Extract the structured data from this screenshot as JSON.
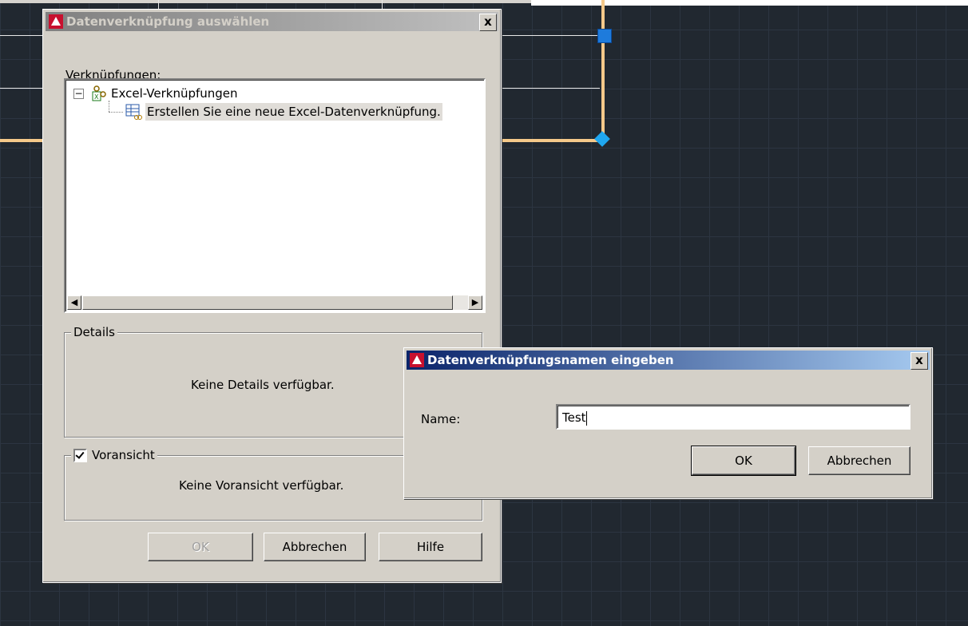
{
  "dialog_main": {
    "title": "Datenverknüpfung auswählen",
    "close_label": "x",
    "links_label": "Verknüpfungen:",
    "tree": {
      "root_label": "Excel-Verknüpfungen",
      "expander": "−",
      "child_label": "Erstellen Sie eine neue Excel-Datenverknüpfung."
    },
    "scroll_left": "◀",
    "scroll_right": "▶",
    "details_label": "Details",
    "details_text": "Keine Details verfügbar.",
    "preview_label": "Voransicht",
    "preview_text": "Keine Voransicht verfügbar.",
    "ok_label": "OK",
    "cancel_label": "Abbrechen",
    "help_label": "Hilfe"
  },
  "dialog_name": {
    "title": "Datenverknüpfungsnamen eingeben",
    "close_label": "x",
    "name_label": "Name:",
    "name_value": "Test",
    "ok_label": "OK",
    "cancel_label": "Abbrechen"
  },
  "colors": {
    "cad_background": "#212830",
    "grip_selected": "#1e7bdc",
    "polyline": "#f5c98a",
    "active_title": "#0a246a"
  }
}
